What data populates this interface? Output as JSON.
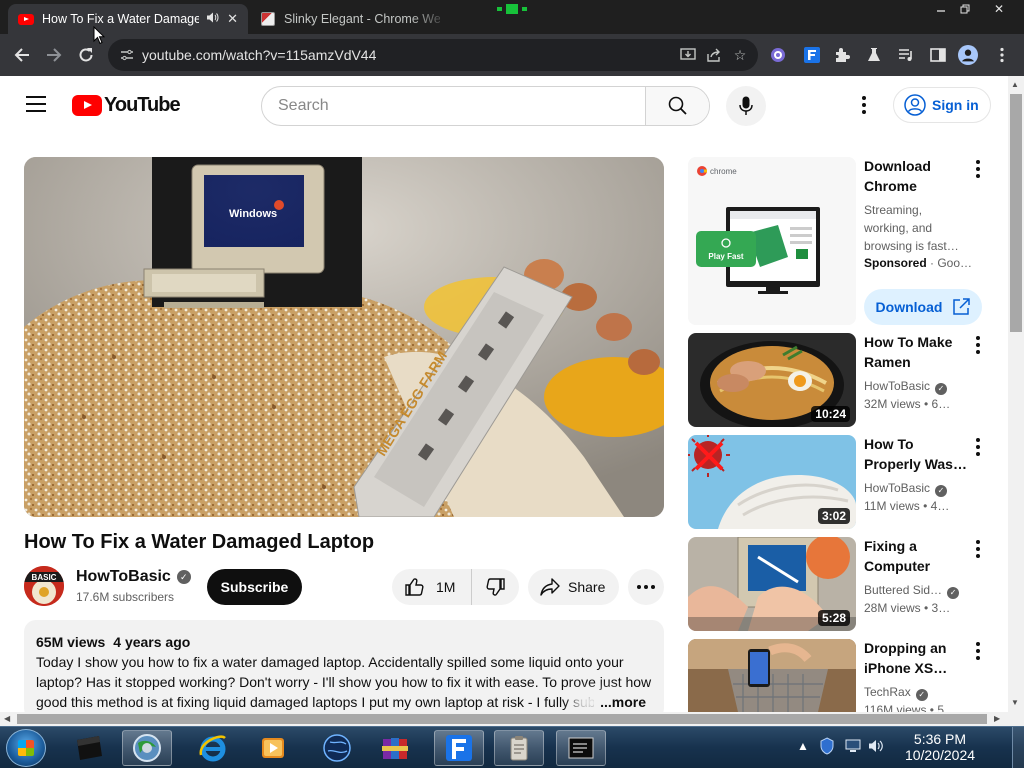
{
  "browser": {
    "tabs": [
      {
        "title": "How To Fix a Water Damage",
        "active": true
      },
      {
        "title": "Slinky Elegant - Chrome Wel",
        "active": false
      }
    ],
    "url": "youtube.com/watch?v=115amzVdV44"
  },
  "masthead": {
    "logo_text": "YouTube",
    "search_placeholder": "Search",
    "sign_in_label": "Sign in"
  },
  "video": {
    "title": "How To Fix a Water Damaged Laptop",
    "channel": {
      "name": "HowToBasic",
      "subscribers": "17.6M subscribers",
      "avatar_text": "BASIC"
    },
    "subscribe_label": "Subscribe",
    "likes": "1M",
    "share_label": "Share",
    "views": "65M views",
    "age": "4 years ago",
    "description": "Today I show you how to fix a water damaged laptop. Accidentally spilled some liquid onto your laptop? Has it stopped working? Don't worry - I'll show you how to fix it with ease. To prove just how good this method is at fixing liquid damaged laptops I put my own laptop at risk - I fully sub",
    "more_label": "...more"
  },
  "sidebar": {
    "ad": {
      "title_line1": "Download",
      "title_line2": "Chrome",
      "desc_line1": "Streaming,",
      "desc_line2": "working, and",
      "desc_line3": "browsing is fast…",
      "sponsored": "Sponsored",
      "advertiser": "· Goo…",
      "button_label": "Download",
      "thumb_logo": "chrome",
      "thumb_cta": "Play Fast"
    },
    "videos": [
      {
        "title_line1": "How To Make",
        "title_line2": "Ramen",
        "channel": "HowToBasic",
        "stats": "32M views  • 6…",
        "duration": "10:24"
      },
      {
        "title_line1": "How To",
        "title_line2": "Properly Was…",
        "channel": "HowToBasic",
        "stats": "11M views  • 4…",
        "duration": "3:02"
      },
      {
        "title_line1": "Fixing a",
        "title_line2": "Computer",
        "channel": "Buttered Sid…",
        "stats": "28M views  • 3…",
        "duration": "5:28"
      },
      {
        "title_line1": "Dropping an",
        "title_line2": "iPhone XS…",
        "channel": "TechRax",
        "stats": "116M views  • 5…",
        "duration": ""
      }
    ]
  },
  "taskbar": {
    "time": "5:36 PM",
    "date": "10/20/2024"
  },
  "colors": {
    "youtube_red": "#ff0000",
    "link_blue": "#065fd4",
    "chrome_dark": "#35363a",
    "taskbar": "#17324e"
  }
}
